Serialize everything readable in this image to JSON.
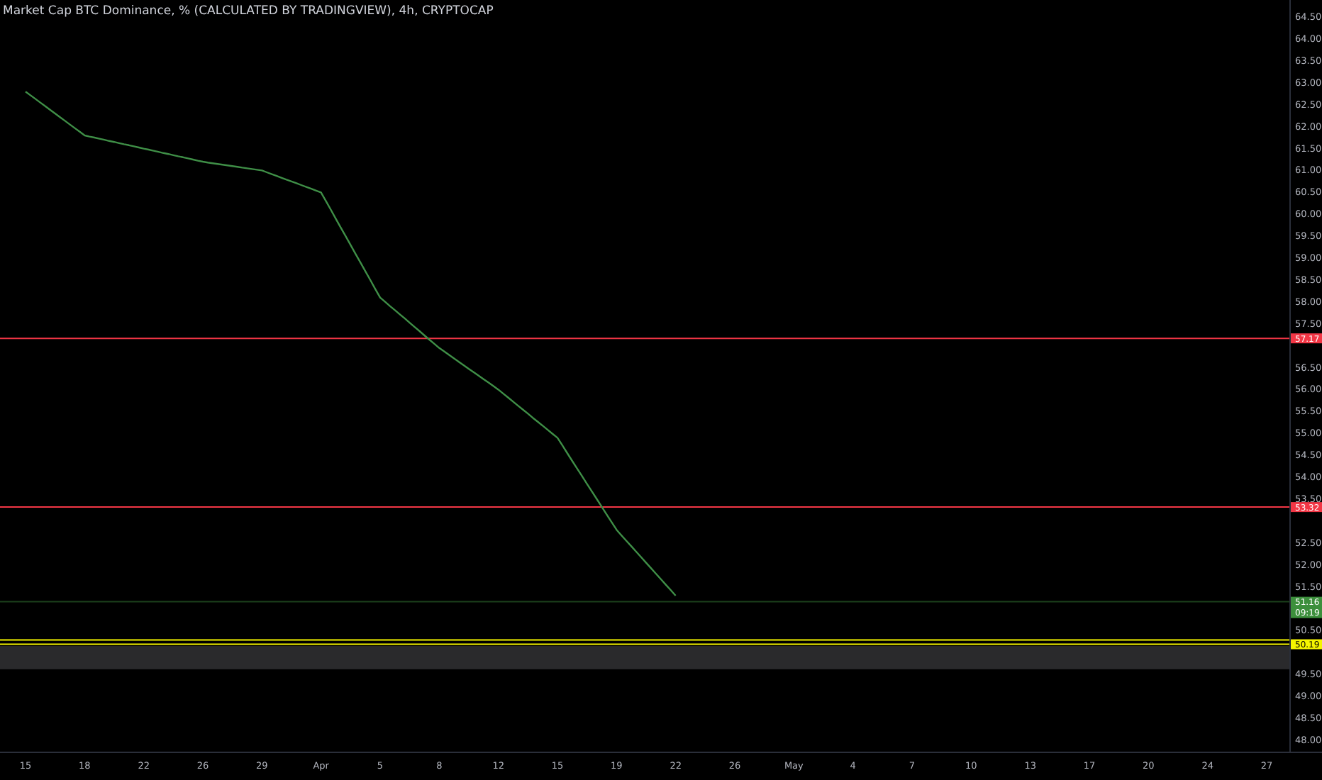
{
  "title": "Market Cap BTC Dominance, % (CALCULATED BY TRADINGVIEW), 4h, CRYPTOCAP",
  "chart_data": {
    "type": "line",
    "categories": [
      "15",
      "18",
      "22",
      "26",
      "29",
      "Apr",
      "5",
      "8",
      "12",
      "15",
      "19",
      "22",
      "26",
      "May",
      "4",
      "7",
      "10",
      "13",
      "17",
      "20",
      "24",
      "27"
    ],
    "series": [
      {
        "color": "#3f8f47",
        "values": [
          62.8,
          61.8,
          61.5,
          61.2,
          61.0,
          60.5,
          58.1,
          56.95,
          56.0,
          54.9,
          52.8,
          51.3,
          null,
          null,
          null,
          null,
          null,
          null,
          null,
          null,
          null,
          null
        ]
      }
    ],
    "ylim": [
      47.74,
      64.89
    ],
    "yticks": [
      {
        "value": 48,
        "label": "48.00"
      },
      {
        "value": 48.5,
        "label": "48.50"
      },
      {
        "value": 49,
        "label": "49.00"
      },
      {
        "value": 49.5,
        "label": "49.50"
      },
      {
        "value": 50.5,
        "label": "50.50"
      },
      {
        "value": 51.5,
        "label": "51.50"
      },
      {
        "value": 52,
        "label": "52.00"
      },
      {
        "value": 52.5,
        "label": "52.50"
      },
      {
        "value": 53.5,
        "label": "53.50"
      },
      {
        "value": 54,
        "label": "54.00"
      },
      {
        "value": 54.5,
        "label": "54.50"
      },
      {
        "value": 55,
        "label": "55.00"
      },
      {
        "value": 55.5,
        "label": "55.50"
      },
      {
        "value": 56,
        "label": "56.00"
      },
      {
        "value": 56.5,
        "label": "56.50"
      },
      {
        "value": 57.5,
        "label": "57.50"
      },
      {
        "value": 58,
        "label": "58.00"
      },
      {
        "value": 58.5,
        "label": "58.50"
      },
      {
        "value": 59,
        "label": "59.00"
      },
      {
        "value": 59.5,
        "label": "59.50"
      },
      {
        "value": 60,
        "label": "60.00"
      },
      {
        "value": 60.5,
        "label": "60.50"
      },
      {
        "value": 61,
        "label": "61.00"
      },
      {
        "value": 61.5,
        "label": "61.50"
      },
      {
        "value": 62,
        "label": "62.00"
      },
      {
        "value": 62.5,
        "label": "62.50"
      },
      {
        "value": 63,
        "label": "63.00"
      },
      {
        "value": 63.5,
        "label": "63.50"
      },
      {
        "value": 64,
        "label": "64.00"
      },
      {
        "value": 64.5,
        "label": "64.50"
      }
    ],
    "bands": [
      {
        "axis": "y",
        "from": 50.15,
        "to": 49.62,
        "color": "#2a2a2c"
      }
    ],
    "ref_lines": [
      {
        "axis": "y",
        "value": 57.17,
        "label": "57.17",
        "color": "#f23645"
      },
      {
        "axis": "y",
        "value": 53.32,
        "label": "53.32",
        "color": "#f23645"
      },
      {
        "axis": "y",
        "value": 51.16,
        "label": "51.16",
        "color": "#3c8f3c"
      },
      {
        "axis": "y",
        "value": 50.29,
        "color": "#f5f500"
      },
      {
        "axis": "y",
        "value": 50.19,
        "label": "50.19",
        "color": "#f5f500"
      }
    ]
  },
  "countdown": "09:19"
}
